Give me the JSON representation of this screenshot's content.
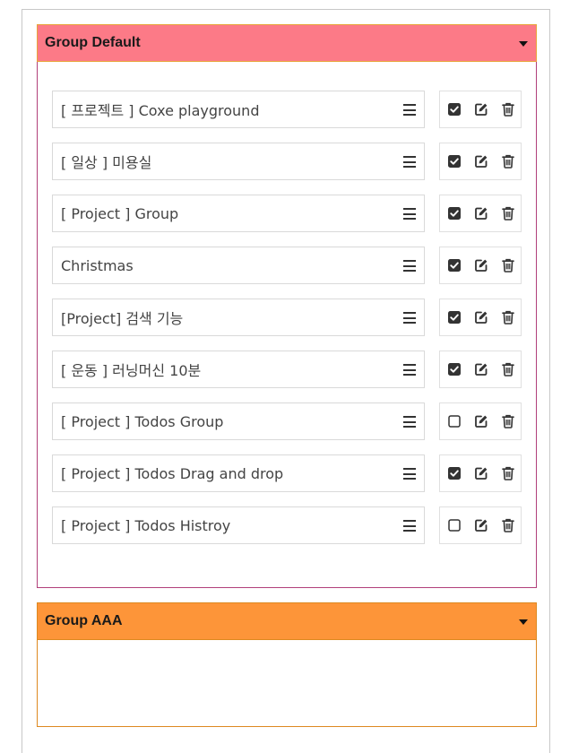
{
  "groups": [
    {
      "title": "Group Default",
      "color": "#fc7a87",
      "todos": [
        {
          "text": "[ 프로젝트 ] Coxe playground",
          "done": true
        },
        {
          "text": "[ 일상 ] 미용실",
          "done": true
        },
        {
          "text": "[ Project ] Group",
          "done": true
        },
        {
          "text": "Christmas",
          "done": true
        },
        {
          "text": "[Project] 검색 기능",
          "done": true
        },
        {
          "text": "[ 운동 ] 러닝머신 10분",
          "done": true
        },
        {
          "text": "[ Project ] Todos Group",
          "done": false
        },
        {
          "text": "[ Project ] Todos Drag and drop",
          "done": true
        },
        {
          "text": "[ Project ] Todos Histroy",
          "done": false
        }
      ]
    },
    {
      "title": "Group AAA",
      "color": "#fd9539",
      "todos": []
    }
  ],
  "icons": {
    "collapse": "chevron-down-icon",
    "drag": "drag-handle-icon",
    "check": "checkbox-icon",
    "edit": "edit-icon",
    "delete": "trash-icon"
  }
}
